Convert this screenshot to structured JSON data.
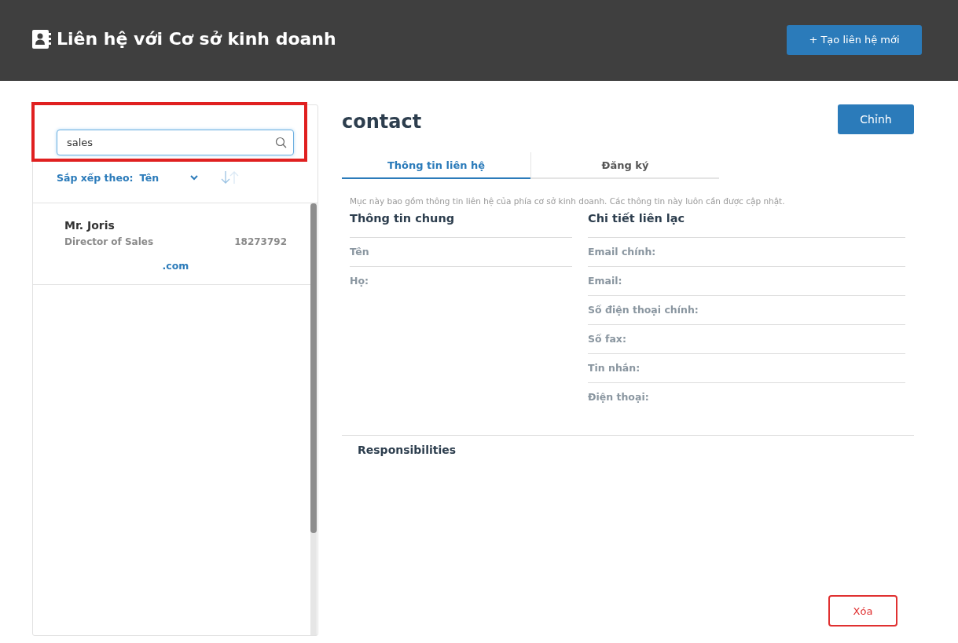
{
  "header": {
    "title": "Liên hệ với Cơ sở kinh doanh",
    "new_button": "+ Tạo liên hệ mới"
  },
  "sidebar": {
    "search": {
      "value": "sales"
    },
    "sort_label": "Sắp xếp theo:",
    "sort_value": "Tên",
    "contacts": [
      {
        "name": "Mr. Joris",
        "job_title": "Director of Sales",
        "phone": "18273792",
        "email": ".com",
        "selected": false
      }
    ]
  },
  "detail": {
    "title": "contact",
    "edit_button": "Chỉnh",
    "tabs": [
      {
        "label": "Thông tin liên hệ",
        "selected": true
      },
      {
        "label": "Đăng ký",
        "selected": false
      }
    ],
    "description": "Mục này bao gồm thông tin liên hệ của phía cơ sở kinh doanh. Các thông tin này luôn cần được cập nhật.",
    "general": {
      "heading": "Thông tin chung",
      "fields": [
        "Tên",
        "Họ:"
      ]
    },
    "contact_details": {
      "heading": "Chi tiết liên lạc",
      "fields": [
        "Email chính:",
        "Email:",
        "Số điện thoại chính:",
        "Số fax:",
        "Tin nhắn:",
        "Điện thoại:"
      ]
    },
    "responsibilities": "Responsibilities",
    "delete_button": "Xóa"
  }
}
